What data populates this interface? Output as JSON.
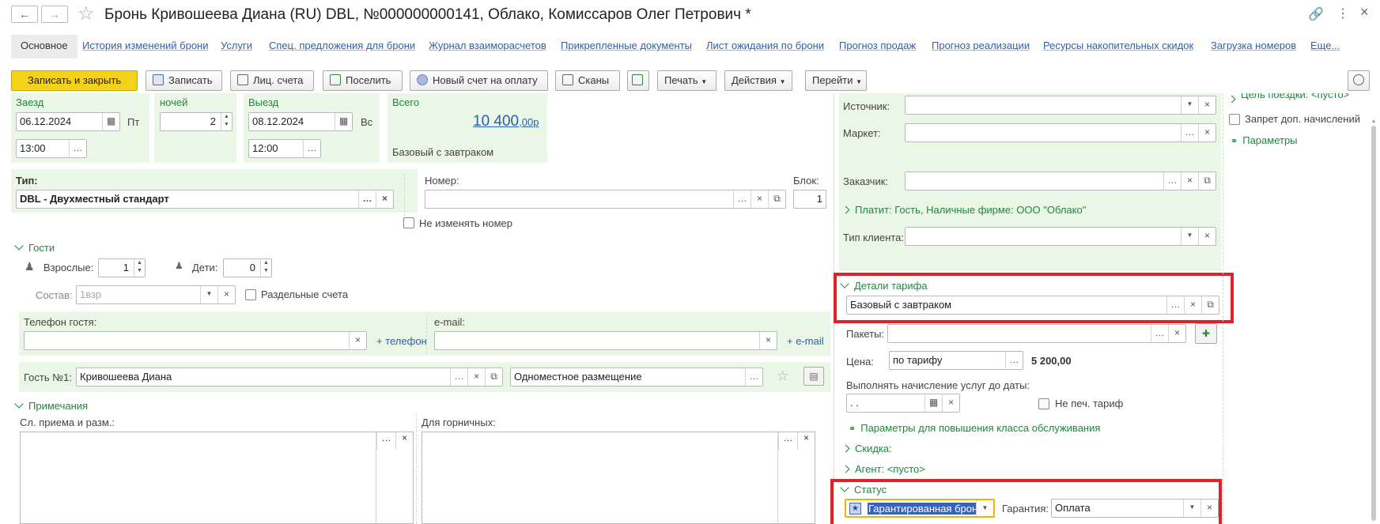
{
  "window": {
    "title": "Бронь Кривошеева Диана (RU) DBL, №000000000141, Облако, Комиссаров Олег Петрович *"
  },
  "tabs": [
    "Основное",
    "История изменений брони",
    "Услуги",
    "Спец. предложения для брони",
    "Журнал взаиморасчетов",
    "Прикрепленные документы",
    "Лист ожидания по брони",
    "Прогноз продаж",
    "Прогноз реализации",
    "Ресурсы накопительных скидок",
    "Загрузка номеров",
    "Еще..."
  ],
  "toolbar": {
    "save_close": "Записать и закрыть",
    "save": "Записать",
    "accounts": "Лиц. счета",
    "checkin": "Поселить",
    "new_invoice": "Новый счет на оплату",
    "scans": "Сканы",
    "print": "Печать",
    "actions": "Действия",
    "goto": "Перейти"
  },
  "stay": {
    "arrival_label": "Заезд",
    "arrival_date": "06.12.2024",
    "arrival_day": "Пт",
    "arrival_time": "13:00",
    "nights_label": "ночей",
    "nights": "2",
    "departure_label": "Выезд",
    "departure_date": "08.12.2024",
    "departure_day": "Вс",
    "departure_time": "12:00",
    "total_label": "Всего",
    "total_amount": "10 400",
    "total_cents": ",00",
    "total_currency": "р",
    "rate_name": "Базовый с завтраком"
  },
  "room": {
    "type_label": "Тип:",
    "type_value": "DBL - Двухместный стандарт",
    "number_label": "Номер:",
    "number_value": "",
    "block_label": "Блок:",
    "block_value": "1",
    "keep_number": "Не изменять номер"
  },
  "guests": {
    "title": "Гости",
    "adults_label": "Взрослые:",
    "adults": "1",
    "children_label": "Дети:",
    "children": "0",
    "composition_label": "Состав:",
    "composition_placeholder": "1взр",
    "separate_accounts": "Раздельные счета",
    "phone_label": "Телефон гостя:",
    "add_phone": "+ телефон",
    "email_label": "e-mail:",
    "add_email": "+ e-mail",
    "guest1_label": "Гость №1:",
    "guest1_name": "Кривошеева Диана",
    "guest1_accommodation": "Одноместное размещение"
  },
  "notes": {
    "title": "Примечания",
    "reception_label": "Сл. приема и разм.:",
    "housekeeping_label": "Для горничных:"
  },
  "right": {
    "source_label": "Источник:",
    "market_label": "Маркет:",
    "customer_label": "Заказчик:",
    "payer_text": "Платит: Гость, Наличные фирме: ООО \"Облако\"",
    "client_type_label": "Тип клиента:",
    "rate_details_title": "Детали тарифа",
    "rate_details_value": "Базовый с завтраком",
    "packages_label": "Пакеты:",
    "price_label": "Цена:",
    "price_mode": "по тарифу",
    "price_value": "5 200,00",
    "charge_until_label": "Выполнять начисление услуг до даты:",
    "charge_until_value": " .  . ",
    "no_print_rate": "Не печ. тариф",
    "upgrade_params": "Параметры для повышения класса обслуживания",
    "discount": "Скидка:",
    "agent": "Агент: <пусто>",
    "status_title": "Статус",
    "status_value": "Гарантированная бронь",
    "guarantee_label": "Гарантия:",
    "guarantee_value": "Оплата"
  },
  "far_right": {
    "trip_purpose": "Цель поездки: <пусто>",
    "no_extra_charges": "Запрет доп. начислений",
    "parameters": "Параметры"
  },
  "colors": {
    "accent_green": "#1a8a3a",
    "panel_green": "#eaf7e6",
    "primary_button": "#f5d21a",
    "highlight_red": "#e0202a",
    "link_blue": "#3060b0"
  }
}
